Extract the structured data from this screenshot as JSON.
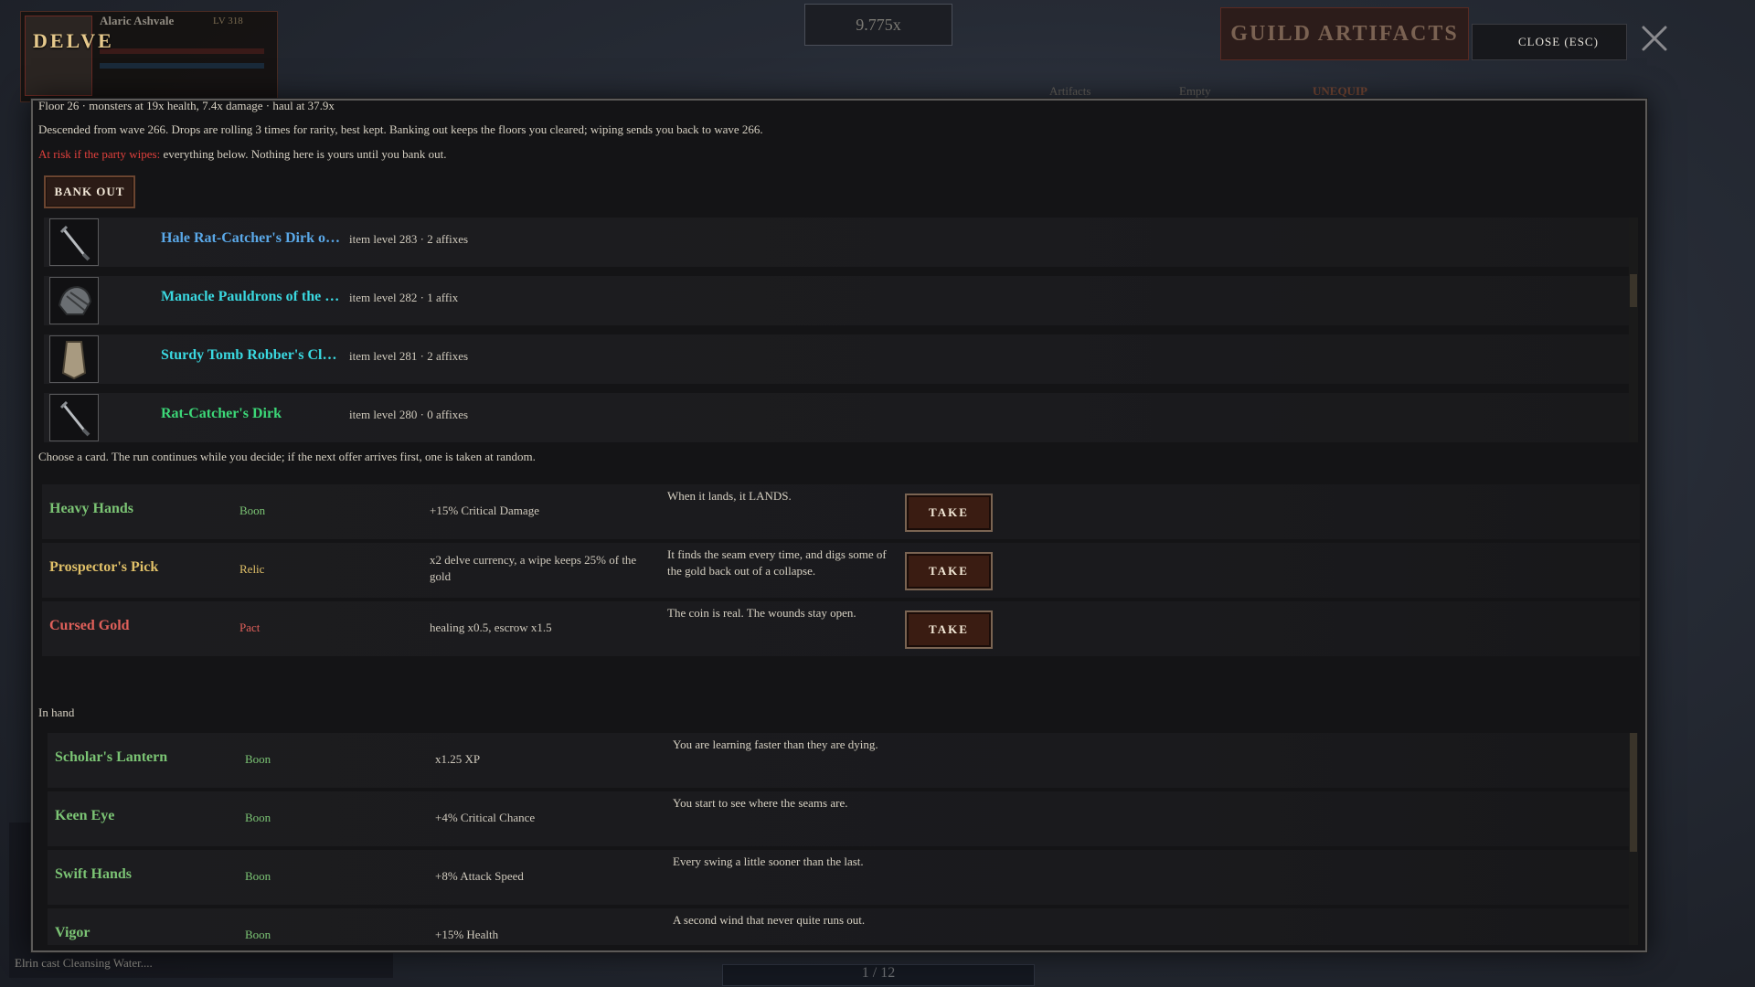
{
  "background": {
    "character_name": "Alaric Ashvale",
    "character_level": "LV 318",
    "wave_multiplier": "9.775x",
    "guild_title": "GUILD ARTIFACTS",
    "tabs": [
      "Artifacts",
      "Empty",
      "UNEQUIP"
    ],
    "combat_log": [
      "Elrin cast Cleansing Water...."
    ],
    "pager": "1 / 12"
  },
  "header": {
    "title": "DELVE",
    "close_label": "CLOSE  (ESC)"
  },
  "status": {
    "floor_line": "Floor 26  ·  monsters at 19x health, 7.4x damage  ·  haul at 37.9x",
    "descent_line": "Descended from wave 266. Drops are rolling 3 times for rarity, best kept. Banking out keeps the floors you cleared; wiping sends you back to wave 266.",
    "risk_label": "At risk if the party wipes:",
    "risk_text": "everything below. Nothing here is yours until you bank out.",
    "bank_out_label": "BANK OUT"
  },
  "loot": [
    {
      "name": "Hale Rat-Catcher's Dirk of the Mole",
      "meta": "item level 283  ·  2 affixes",
      "rarity": "magic",
      "icon": "dagger-icon"
    },
    {
      "name": "Manacle Pauldrons of the Hollow",
      "meta": "item level 282  ·  1 affix",
      "rarity": "rare",
      "icon": "pauldron-icon"
    },
    {
      "name": "Sturdy Tomb Robber's Cloak",
      "meta": "item level 281  ·  2 affixes",
      "rarity": "rare",
      "icon": "cloak-icon"
    },
    {
      "name": "Rat-Catcher's Dirk",
      "meta": "item level 280  ·  0 affixes",
      "rarity": "common",
      "icon": "dagger-icon"
    }
  ],
  "offer": {
    "prompt": "Choose a card. The run continues while you decide; if the next offer arrives first, one is taken at random.",
    "take_label": "TAKE",
    "cards": [
      {
        "name": "Heavy Hands",
        "type": "Boon",
        "effect": "+15% Critical Damage",
        "flavor": "When it lands, it LANDS."
      },
      {
        "name": "Prospector's Pick",
        "type": "Relic",
        "effect": "x2 delve currency, a wipe keeps 25% of the gold",
        "flavor": "It finds the seam every time, and digs some of the gold back out of a collapse."
      },
      {
        "name": "Cursed Gold",
        "type": "Pact",
        "effect": "healing x0.5, escrow x1.5",
        "flavor": "The coin is real. The wounds stay open."
      }
    ]
  },
  "hand": {
    "label": "In hand",
    "cards": [
      {
        "name": "Scholar's Lantern",
        "type": "Boon",
        "effect": "x1.25 XP",
        "flavor": "You are learning faster than they are dying."
      },
      {
        "name": "Keen Eye",
        "type": "Boon",
        "effect": "+4% Critical Chance",
        "flavor": "You start to see where the seams are."
      },
      {
        "name": "Swift Hands",
        "type": "Boon",
        "effect": "+8% Attack Speed",
        "flavor": "Every swing a little sooner than the last."
      },
      {
        "name": "Vigor",
        "type": "Boon",
        "effect": "+15% Health",
        "flavor": "A second wind that never quite runs out."
      }
    ]
  },
  "colors": {
    "boon": "#7bc474",
    "relic": "#e0c068",
    "pact": "#e0605a",
    "magic": "#5aa8e8",
    "rare": "#3ad8e0",
    "common": "#3cd878",
    "risk": "#e0403c",
    "title_gold": "#e6c98c"
  }
}
